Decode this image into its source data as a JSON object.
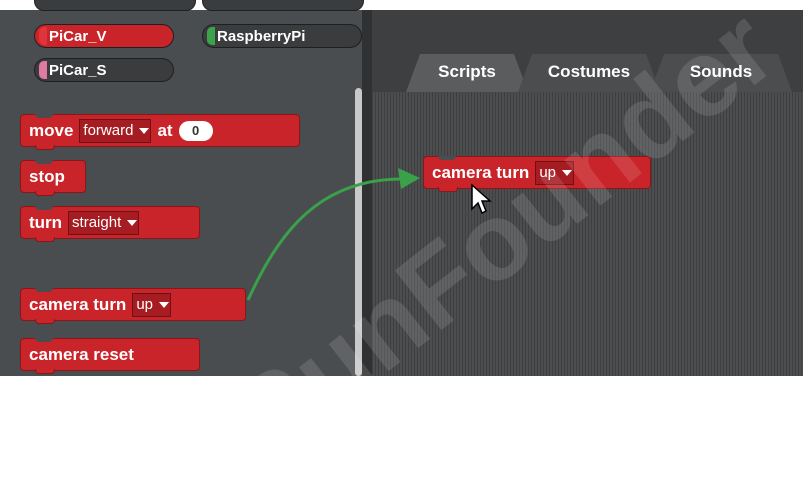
{
  "categories": [
    {
      "label": "PiCar_V",
      "selected": true,
      "swatch": "#e0333b"
    },
    {
      "label": "RaspberryPi",
      "selected": false,
      "swatch": "#3da34a"
    },
    {
      "label": "PiCar_S",
      "selected": false,
      "swatch": "#e07aa0"
    }
  ],
  "palette_blocks": {
    "move": {
      "label": "move",
      "dropdown": "forward",
      "at_label": "at",
      "number": "0"
    },
    "stop": {
      "label": "stop"
    },
    "turn": {
      "label": "turn",
      "dropdown": "straight"
    },
    "camera_turn": {
      "label": "camera turn",
      "dropdown": "up"
    },
    "camera_reset": {
      "label": "camera reset"
    }
  },
  "tabs": [
    {
      "label": "Scripts",
      "active": true
    },
    {
      "label": "Costumes",
      "active": false
    },
    {
      "label": "Sounds",
      "active": false
    }
  ],
  "canvas_block": {
    "label": "camera turn",
    "dropdown": "up"
  },
  "watermark": "SunFounder",
  "colors": {
    "block": "#c9242a",
    "arrow": "#3aa04a"
  }
}
